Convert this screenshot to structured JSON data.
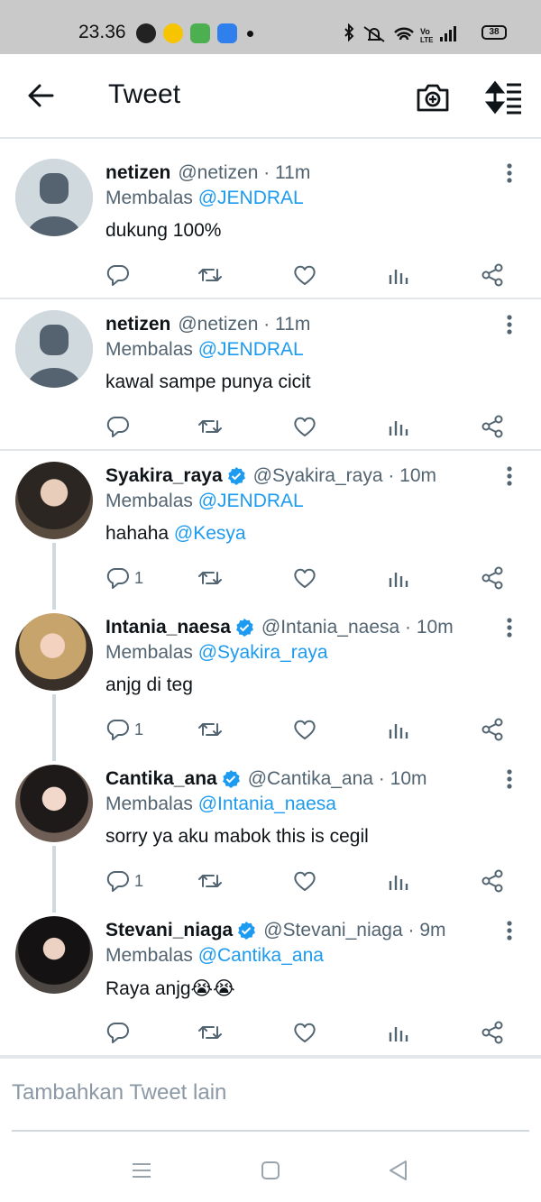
{
  "status_bar": {
    "time": "23.36",
    "battery": "38"
  },
  "header": {
    "title": "Tweet"
  },
  "tweets": [
    {
      "name": "netizen",
      "handle": "@netizen · 11m",
      "verified": false,
      "reply_prefix": "Membalas ",
      "reply_mention": "@JENDRAL",
      "text": "dukung 100%",
      "text_mention": "",
      "reply_count": ""
    },
    {
      "name": "netizen",
      "handle": "@netizen · 11m",
      "verified": false,
      "reply_prefix": "Membalas ",
      "reply_mention": "@JENDRAL",
      "text": "kawal sampe punya cicit",
      "text_mention": "",
      "reply_count": ""
    },
    {
      "name": "Syakira_raya",
      "handle": "@Syakira_raya · 10m",
      "verified": true,
      "reply_prefix": "Membalas ",
      "reply_mention": "@JENDRAL",
      "text": "hahaha ",
      "text_mention": "@Kesya",
      "reply_count": "1"
    },
    {
      "name": "Intania_naesa",
      "handle": "@Intania_naesa · 10m",
      "verified": true,
      "reply_prefix": "Membalas ",
      "reply_mention": "@Syakira_raya",
      "text": "anjg di teg",
      "text_mention": "",
      "reply_count": "1"
    },
    {
      "name": "Cantika_ana",
      "handle": "@Cantika_ana · 10m",
      "verified": true,
      "reply_prefix": "Membalas ",
      "reply_mention": "@Intania_naesa",
      "text": "sorry ya aku mabok this is cegil",
      "text_mention": "",
      "reply_count": "1"
    },
    {
      "name": "Stevani_niaga",
      "handle": "@Stevani_niaga · 9m",
      "verified": true,
      "reply_prefix": "Membalas ",
      "reply_mention": "@Cantika_ana",
      "text": "Raya anjg😭😭",
      "text_mention": "",
      "reply_count": ""
    }
  ],
  "compose": {
    "placeholder": "Tambahkan Tweet lain"
  },
  "colors": {
    "accent": "#1d9bf0",
    "secondary_text": "#536471",
    "divider": "#e4e7e9"
  },
  "icons": [
    "back-arrow-icon",
    "camera-add-icon",
    "sort-icon",
    "reply-icon",
    "retweet-icon",
    "like-icon",
    "analytics-icon",
    "share-icon",
    "more-icon",
    "verified-icon"
  ]
}
